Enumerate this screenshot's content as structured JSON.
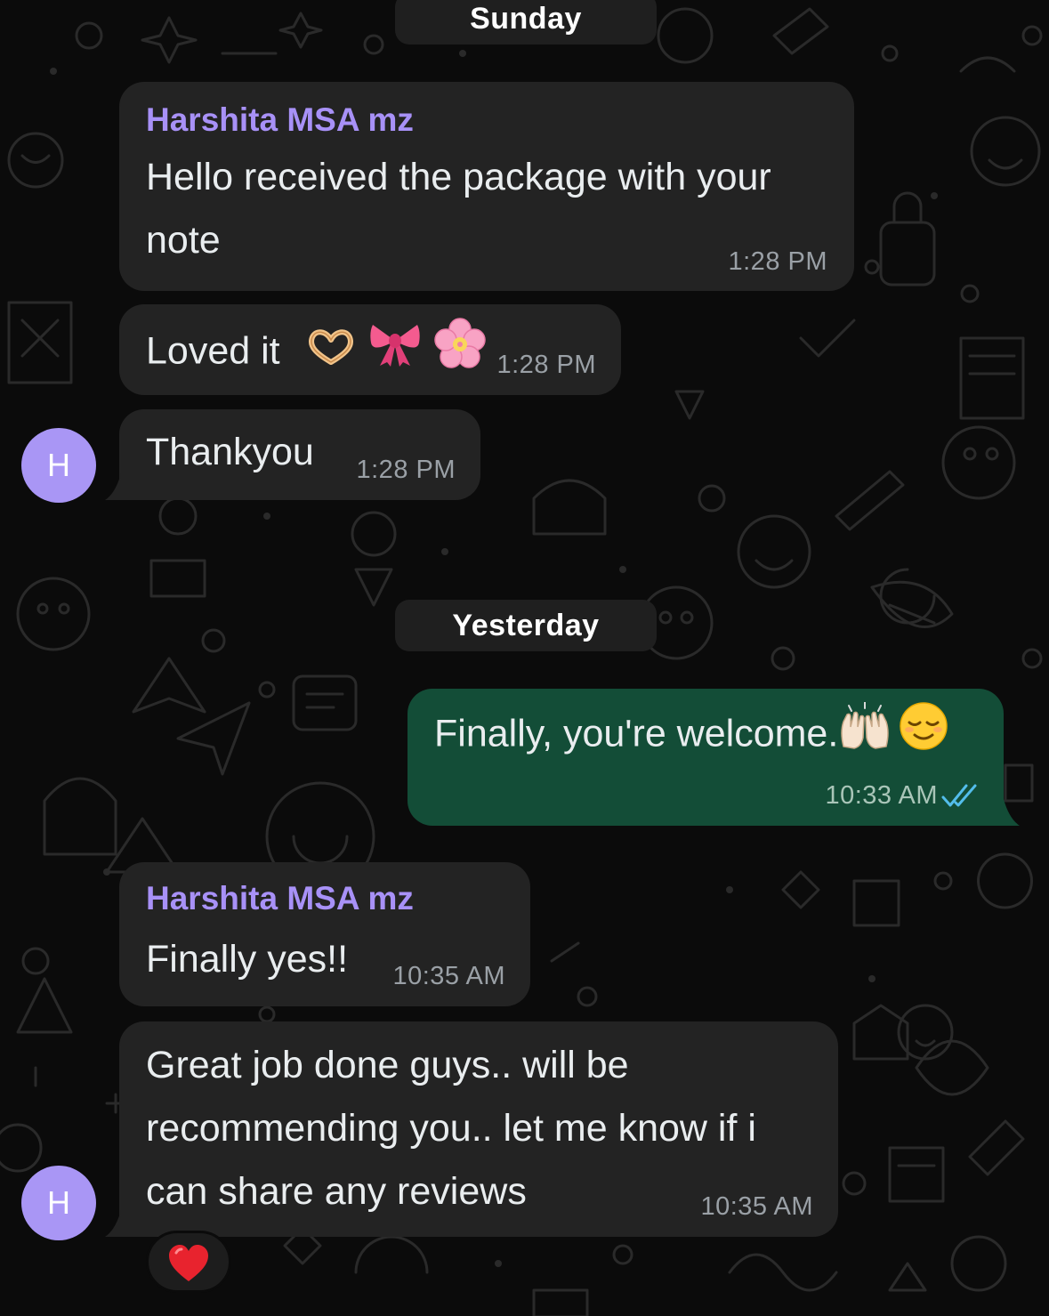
{
  "dates": {
    "sunday": "Sunday",
    "yesterday": "Yesterday"
  },
  "messages": [
    {
      "direction": "incoming",
      "sender": "Harshita MSA mz",
      "lines": [
        "Hello received the package with your",
        "note"
      ],
      "time": "1:28 PM"
    },
    {
      "direction": "incoming",
      "text": "Loved it",
      "emojis": [
        "heart-hands-emoji",
        "ribbon-emoji",
        "cherry-blossom-emoji"
      ],
      "time": "1:28 PM"
    },
    {
      "direction": "incoming",
      "text": "Thankyou",
      "time": "1:28 PM",
      "avatar": "H"
    },
    {
      "direction": "outgoing",
      "text": "Finally, you're welcome.",
      "emojis": [
        "raising-hands-emoji",
        "relieved-face-emoji"
      ],
      "time": "10:33 AM",
      "status": "read",
      "status_icon": "double-check-icon",
      "status_color": "#53bdeb"
    },
    {
      "direction": "incoming",
      "sender": "Harshita MSA mz",
      "text": "Finally yes!!",
      "time": "10:35 AM"
    },
    {
      "direction": "incoming",
      "lines": [
        "Great job done guys.. will be",
        "recommending you.. let me know if i",
        "can share any reviews"
      ],
      "time": "10:35 AM",
      "avatar": "H",
      "reaction": "red-heart-emoji"
    }
  ],
  "colors": {
    "background": "#0b0b0b",
    "incoming_bubble": "#232323",
    "outgoing_bubble": "#134d37",
    "sender_name": "#a891f7",
    "avatar": "#a996f5",
    "read_ticks": "#53bdeb"
  }
}
